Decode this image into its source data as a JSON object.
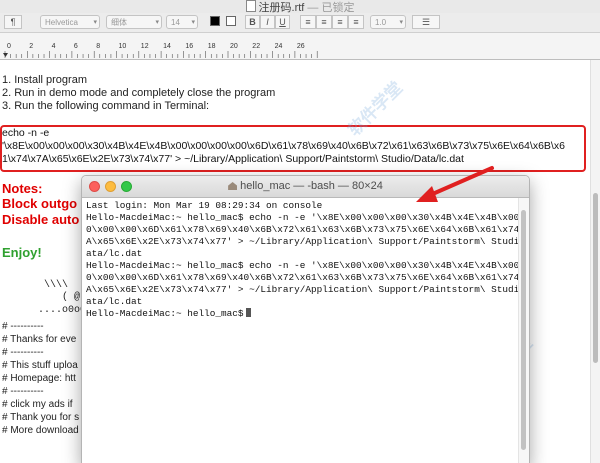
{
  "textedit": {
    "title": "注册码.rtf",
    "status": "— 已锁定",
    "toolbar": {
      "font_family": "Helvetica",
      "font_style": "细体",
      "font_size": "14",
      "line_spacing": "1.0"
    },
    "ruler": {
      "ticks": [
        "0",
        "2",
        "4",
        "6",
        "8",
        "10",
        "12",
        "14",
        "16",
        "18",
        "20",
        "22",
        "24",
        "26"
      ]
    },
    "doc": {
      "steps": [
        "1. Install program",
        "2. Run in demo mode and completely close the program",
        "3. Run the following command in Terminal:"
      ],
      "command_lines": [
        "echo -n -e",
        "'\\x8E\\x00\\x00\\x00\\x30\\x4B\\x4E\\x4B\\x00\\x00\\x00\\x00\\x6D\\x61\\x78\\x69\\x40\\x6B\\x72\\x61\\x63\\x6B\\x73\\x75\\x6E\\x64\\x6B\\x6",
        "1\\x74\\x7A\\x65\\x6E\\x2E\\x73\\x74\\x77' > ~/Library/Application\\ Support/Paintstorm\\ Studio/Data/lc.dat"
      ],
      "notes": [
        "Notes:",
        "Block outgo",
        "Disable auto"
      ],
      "enjoy": "Enjoy!",
      "art": [
        "\\\\\\\\",
        "( @",
        "....o0o0.("
      ],
      "comments": [
        "# ----------",
        "# Thanks for eve",
        "# ----------",
        "# This stuff uploa",
        "# Homepage: htt",
        "# ----------",
        "# click my ads if",
        "# Thank you for s",
        "# More download"
      ]
    }
  },
  "terminal": {
    "title": "hello_mac — -bash — 80×24",
    "lines": [
      "Last login: Mon Mar 19 08:29:34 on console",
      "Hello-MacdeiMac:~ hello_mac$ echo -n -e '\\x8E\\x00\\x00\\x00\\x30\\x4B\\x4E\\x4B\\x00\\x0",
      "0\\x00\\x00\\x6D\\x61\\x78\\x69\\x40\\x6B\\x72\\x61\\x63\\x6B\\x73\\x75\\x6E\\x64\\x6B\\x61\\x74\\x7",
      "A\\x65\\x6E\\x2E\\x73\\x74\\x77' > ~/Library/Application\\ Support/Paintstorm\\ Studio/D",
      "ata/lc.dat",
      "Hello-MacdeiMac:~ hello_mac$ echo -n -e '\\x8E\\x00\\x00\\x00\\x30\\x4B\\x4E\\x4B\\x00\\x0",
      "0\\x00\\x00\\x6D\\x61\\x78\\x69\\x40\\x6B\\x72\\x61\\x63\\x6B\\x73\\x75\\x6E\\x64\\x6B\\x61\\x74\\x7",
      "A\\x65\\x6E\\x2E\\x73\\x74\\x77' > ~/Library/Application\\ Support/Paintstorm\\ Studio/D",
      "ata/lc.dat",
      "Hello-MacdeiMac:~ hello_mac$"
    ]
  },
  "watermark": {
    "text": "软件学堂"
  },
  "colors": {
    "highlight": "#e02020",
    "notes": "#e00000",
    "enjoy": "#2fa02f"
  }
}
